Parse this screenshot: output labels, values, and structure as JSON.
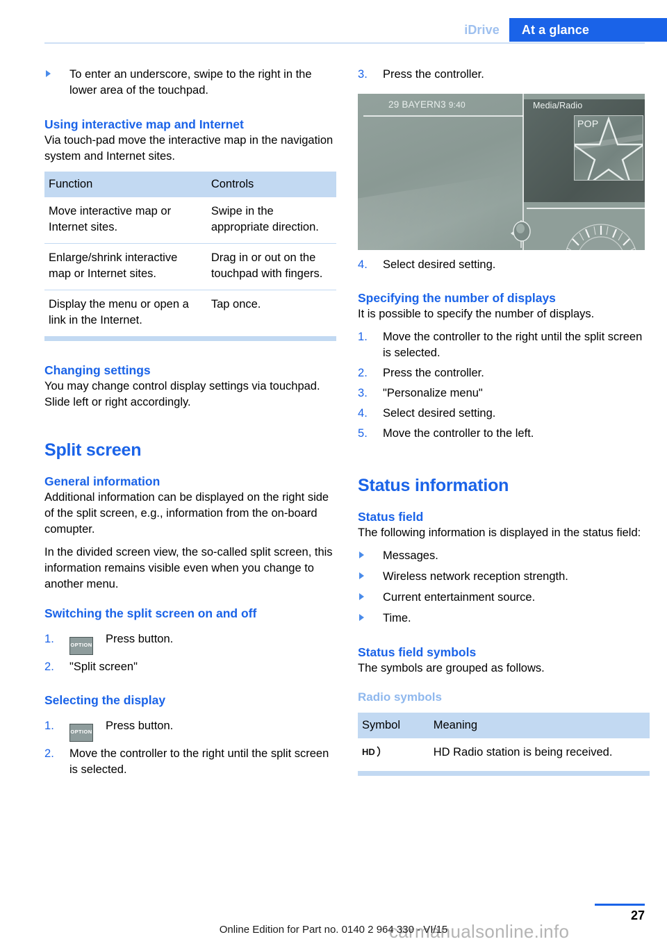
{
  "header": {
    "chapter": "iDrive",
    "section": "At a glance"
  },
  "left_column": {
    "intro_bullet": "To enter an underscore, swipe to the right in the lower area of the touchpad.",
    "heading_using_map": "Using interactive map and Internet",
    "using_map_text": "Via touch-pad move the interactive map in the navigation system and Internet sites.",
    "table": {
      "headers": [
        "Function",
        "Controls"
      ],
      "rows": [
        [
          "Move interactive map or Internet sites.",
          "Swipe in the appropriate direction."
        ],
        [
          "Enlarge/shrink interactive map or Internet sites.",
          "Drag in or out on the touchpad with fingers."
        ],
        [
          "Display the menu or open a link in the Internet.",
          "Tap once."
        ]
      ]
    },
    "heading_changing_settings": "Changing settings",
    "changing_settings_text": "You may change control display settings via touchpad. Slide left or right accordingly.",
    "chapter_title_split_screen": "Split screen",
    "heading_general_information": "General information",
    "general_info_p1": "Additional information can be displayed on the right side of the split screen, e.g., information from the on-board comupter.",
    "general_info_p2": "In the divided screen view, the so-called split screen, this information remains visible even when you change to another menu.",
    "heading_switching": "Switching the split screen on and off",
    "switching_steps": [
      "Press button.",
      "\"Split screen\""
    ],
    "heading_selecting_display": "Selecting the display",
    "selecting_steps": [
      "Press button.",
      "Move the controller to the right until the split screen is selected."
    ],
    "option_button_label": "OPTION"
  },
  "right_column": {
    "step_3": "Press the controller.",
    "figure": {
      "status_station": "29 BAYERN3",
      "status_time": "9:40",
      "menu_label": "Media/Radio",
      "cover_label": "POP"
    },
    "step_4": "Select desired setting.",
    "heading_specifying_displays": "Specifying the number of displays",
    "specifying_text": "It is possible to specify the number of displays.",
    "specifying_steps": [
      "Move the controller to the right until the split screen is selected.",
      "Press the controller.",
      "\"Personalize menu\"",
      "Select desired setting.",
      "Move the controller to the left."
    ],
    "chapter_title_status": "Status information",
    "heading_status_field": "Status field",
    "status_field_text": "The following information is displayed in the status field:",
    "status_field_bullets": [
      "Messages.",
      "Wireless network reception strength.",
      "Current entertainment source.",
      "Time."
    ],
    "heading_status_symbols": "Status field symbols",
    "status_symbols_text": "The symbols are grouped as follows.",
    "subheading_radio_symbols": "Radio symbols",
    "symbol_table": {
      "headers": [
        "Symbol",
        "Meaning"
      ],
      "rows": [
        {
          "symbol": "hd-radio-icon",
          "meaning": "HD Radio station is being received."
        }
      ]
    }
  },
  "footer": {
    "edition_text": "Online Edition for Part no. 0140 2 964 330 - VI/15",
    "page_number": "27",
    "watermark": "carmanualsonline.info"
  },
  "colors": {
    "accent_blue": "#1a63e8",
    "light_blue": "#8fb8ee",
    "table_header": "#c2d9f2",
    "header_chapter": "#9ec0ef"
  }
}
